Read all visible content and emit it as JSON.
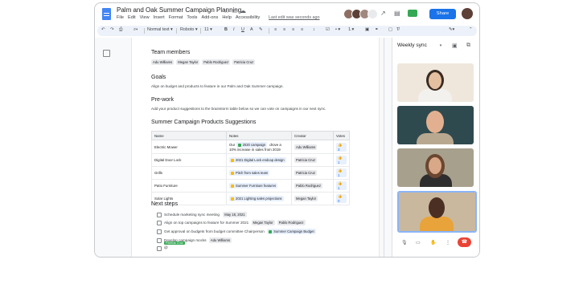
{
  "header": {
    "doc_title": "Palm and Oak Summer Campaign Planning",
    "menus": [
      "File",
      "Edit",
      "View",
      "Insert",
      "Format",
      "Tools",
      "Add-ons",
      "Help",
      "Accessibility"
    ],
    "last_edit": "Last edit was seconds ago",
    "share_label": "Share"
  },
  "toolbar": {
    "style": "Normal text",
    "font": "Roboto",
    "size": "11"
  },
  "doc": {
    "team_heading": "Team members",
    "team": [
      "Adu Williams",
      "Megan Taylor",
      "Pablo Rodriguez",
      "Patricia Cruz"
    ],
    "goals_heading": "Goals",
    "goals_text": "Align on budget and products to feature in our Palm and Oak Summer campaign.",
    "prework_heading": "Pre-work",
    "prework_text": "Add your product suggestions to the brainstorm table below so we can vote on campaigns in our next sync.",
    "table_heading": "Summer Campaign Products Suggestions",
    "table": {
      "headers": [
        "Name",
        "Notes",
        "Creator",
        "Votes"
      ],
      "rows": [
        {
          "name": "Electric Mower",
          "note_pre": "Our",
          "note_file": "2020 campaign",
          "note_post": "drove a",
          "note_line2": "10% increase in sales from 2019",
          "creator": "Adu Williams",
          "votes": "3"
        },
        {
          "name": "Digital Door Lock",
          "note_file": "2021 Digital Lock endcap design",
          "creator": "Patricia Cruz",
          "votes": "1"
        },
        {
          "name": "Grills",
          "note_file": "Pitch from sales team",
          "creator": "Patricia Cruz",
          "votes": "1"
        },
        {
          "name": "Patio Furniture",
          "note_file": "Summer Furniture features",
          "creator": "Pablo Rodriguez",
          "votes": "1"
        },
        {
          "name": "Solar Lights",
          "note_file": "2021 Lighting sales projections",
          "creator": "Megan Taylor",
          "votes": "0"
        }
      ]
    },
    "next_heading": "Next steps",
    "steps": [
      {
        "text": "Schedule marketing sync meeting",
        "chips": [
          "May 18, 2021"
        ]
      },
      {
        "text": "Align on top campaigns to feature for Summer 2021",
        "chips": [
          "Megan Taylor",
          "Pablo Rodriguez"
        ]
      },
      {
        "text": "Get approval on budgets from budget committee Chairperson",
        "chips": [
          "Summer Campaign Budget"
        ]
      },
      {
        "text": "Develop campaign mocks",
        "chips": [
          "Adu Williams"
        ]
      },
      {
        "text": "@",
        "chips": []
      }
    ],
    "cursor_label": "Patricia Cruz"
  },
  "side_panel": {
    "title": "Weekly sync"
  },
  "colors": {
    "share": "#1a73e8",
    "hangup": "#ea4335",
    "toolbar_bg": "#edf2fa",
    "cursor": "#34a853"
  }
}
